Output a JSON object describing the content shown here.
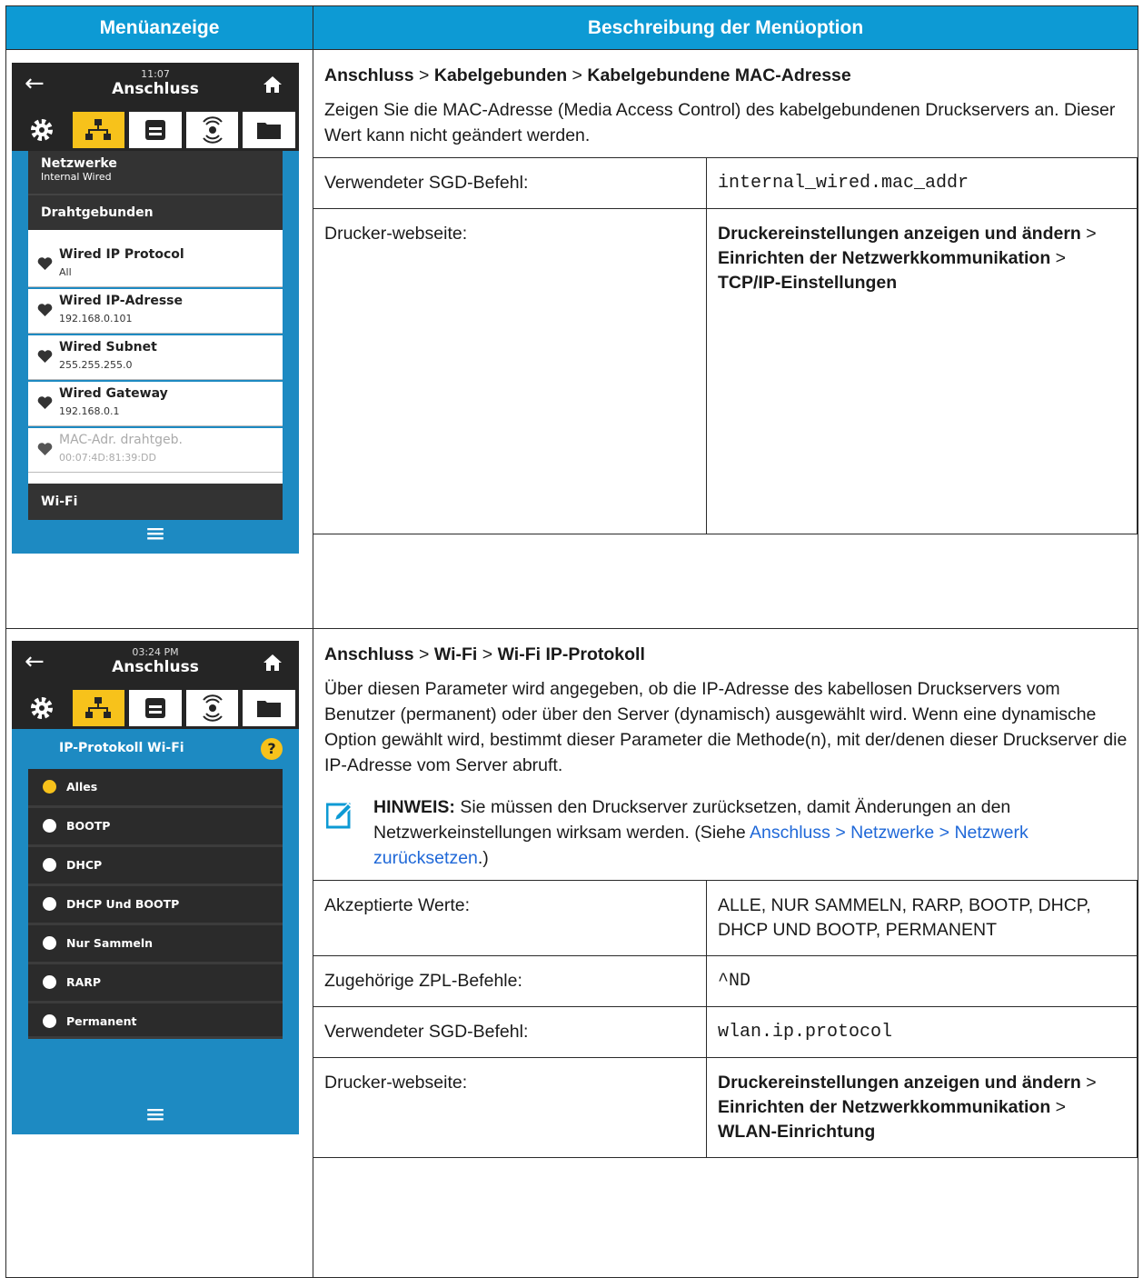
{
  "header": {
    "col1": "Menüanzeige",
    "col2": "Beschreibung der Menüoption"
  },
  "section1": {
    "path": [
      "Anschluss",
      "Kabelgebunden",
      "Kabelgebundene MAC-Adresse"
    ],
    "separator": ">",
    "description": "Zeigen Sie die MAC-Adresse (Media Access Control) des kabelgebundenen Druckservers an. Dieser Wert kann nicht geändert werden.",
    "rows": {
      "sgd_label": "Verwendeter SGD-Befehl:",
      "sgd_value": "internal_wired.mac_addr",
      "web_label": "Drucker-webseite:",
      "web_value": [
        "Druckereinstellungen anzeigen und ändern",
        "Einrichten der Netzwerkkommunikation",
        "TCP/IP-Einstellungen"
      ]
    },
    "screen": {
      "time": "11:07",
      "title": "Anschluss",
      "netzwerke_label": "Netzwerke",
      "netzwerke_sub": "Internal Wired",
      "section_label": "Drahtgebunden",
      "items": [
        {
          "label": "Wired IP Protocol",
          "value": "All"
        },
        {
          "label": "Wired IP-Adresse",
          "value": "192.168.0.101"
        },
        {
          "label": "Wired Subnet",
          "value": "255.255.255.0"
        },
        {
          "label": "Wired Gateway",
          "value": "192.168.0.1"
        },
        {
          "label": "MAC-Adr. drahtgeb.",
          "value": "00:07:4D:81:39:DD"
        }
      ],
      "footer_section": "Wi-Fi"
    }
  },
  "section2": {
    "path": [
      "Anschluss",
      "Wi-Fi",
      "Wi-Fi IP-Protokoll"
    ],
    "separator": ">",
    "description": "Über diesen Parameter wird angegeben, ob die IP-Adresse des kabellosen Druckservers vom Benutzer (permanent) oder über den Server (dynamisch) ausgewählt wird. Wenn eine dynamische Option gewählt wird, bestimmt dieser Parameter die Methode(n), mit der/denen dieser Druckserver die IP-Adresse vom Server abruft.",
    "note": {
      "label": "HINWEIS:",
      "text": "Sie müssen den Druckserver zurücksetzen, damit Änderungen an den Netzwerkeinstellungen wirksam werden. (Siehe",
      "link": "Anschluss > Netzwerke > Netzwerk zurücksetzen",
      "end": ".)"
    },
    "rows": {
      "accepted_label": "Akzeptierte Werte:",
      "accepted_value": "ALLE, NUR SAMMELN, RARP, BOOTP, DHCP, DHCP UND BOOTP, PERMANENT",
      "zpl_label": "Zugehörige ZPL-Befehle:",
      "zpl_value": "^ND",
      "sgd_label": "Verwendeter SGD-Befehl:",
      "sgd_value": "wlan.ip.protocol",
      "web_label": "Drucker-webseite:",
      "web_value": [
        "Druckereinstellungen anzeigen und ändern",
        "Einrichten der Netzwerkkommunikation",
        "WLAN-Einrichtung"
      ]
    },
    "screen": {
      "time": "03:24 PM",
      "title": "Anschluss",
      "heading": "IP-Protokoll Wi-Fi",
      "options": [
        "Alles",
        "BOOTP",
        "DHCP",
        "DHCP Und BOOTP",
        "Nur Sammeln",
        "RARP",
        "Permanent"
      ],
      "selected": "Alles"
    }
  },
  "colors": {
    "header_blue": "#0d9ad4",
    "screen_blue": "#1d8ac2",
    "accent_yellow": "#f7c21b",
    "link_blue": "#1f68d8"
  }
}
